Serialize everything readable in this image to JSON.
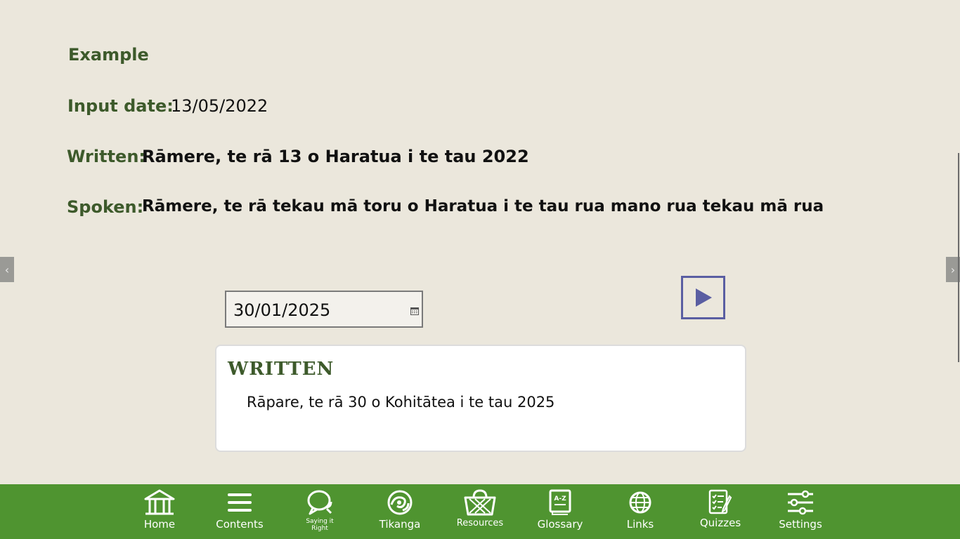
{
  "example": {
    "heading": "Example",
    "input_label": "Input date:",
    "input_value": "13/05/2022",
    "written_label": "Written:",
    "written_value": "Rāmere, te rā 13 o Haratua i te tau 2022",
    "spoken_label": "Spoken:",
    "spoken_value": "Rāmere, te rā tekau mā toru o Haratua i te tau rua mano rua tekau mā rua"
  },
  "date_input": {
    "value": "30/01/2025",
    "icon": "calendar-icon"
  },
  "play_button": {
    "icon": "play-icon"
  },
  "result": {
    "title": "WRITTEN",
    "text": "Rāpare, te rā 30 o Kohitātea i te tau 2025"
  },
  "nav": {
    "items": [
      {
        "label": "Home",
        "icon": "home-icon"
      },
      {
        "label": "Contents",
        "icon": "menu-icon"
      },
      {
        "label": "Saying it Right",
        "icon": "speech-bubbles-icon"
      },
      {
        "label": "Tikanga",
        "icon": "koru-icon"
      },
      {
        "label": "Resources",
        "icon": "basket-icon"
      },
      {
        "label": "Glossary",
        "icon": "book-az-icon"
      },
      {
        "label": "Links",
        "icon": "globe-icon"
      },
      {
        "label": "Quizzes",
        "icon": "checklist-icon"
      },
      {
        "label": "Settings",
        "icon": "sliders-icon"
      }
    ]
  },
  "colors": {
    "background": "#ebe7dc",
    "label_green": "#3d5a2b",
    "nav_green": "#4f9430",
    "play_border": "#5a5ea2"
  }
}
